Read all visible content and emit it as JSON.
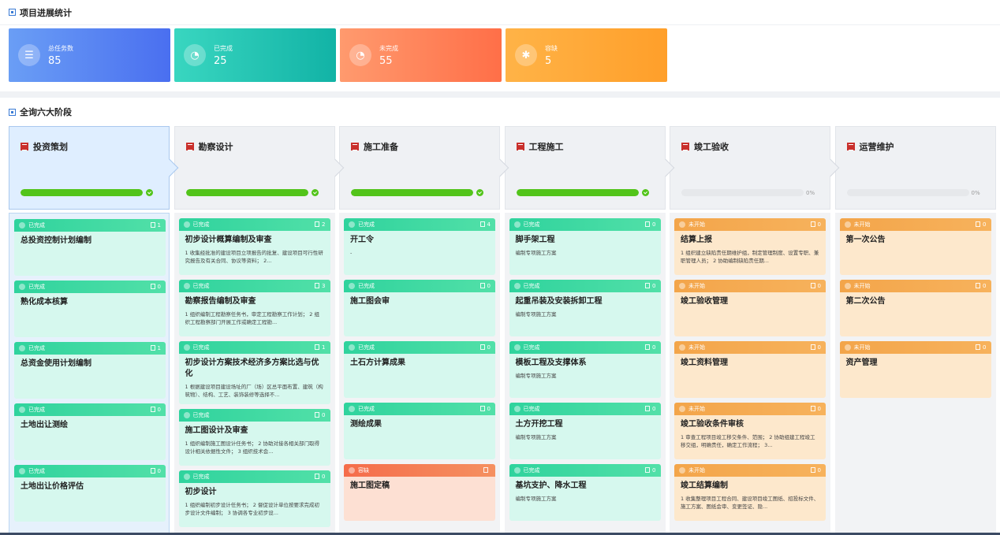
{
  "progress_section": {
    "title": "项目进展统计"
  },
  "stats": [
    {
      "label": "总任务数",
      "value": "85",
      "icon": "layers-icon"
    },
    {
      "label": "已完成",
      "value": "25",
      "icon": "chart-icon"
    },
    {
      "label": "未完成",
      "value": "55",
      "icon": "chart-icon"
    },
    {
      "label": "容缺",
      "value": "5",
      "icon": "puzzle-icon"
    }
  ],
  "stages_section": {
    "title": "全询六大阶段"
  },
  "colors": {
    "done": "#2fd39d",
    "todo": "#f3a54a",
    "missing": "#f56c4a",
    "progress": "#52c41a"
  },
  "stages": [
    {
      "name": "投资策划",
      "progress": 100,
      "pct_text": ""
    },
    {
      "name": "勘察设计",
      "progress": 100,
      "pct_text": ""
    },
    {
      "name": "施工准备",
      "progress": 100,
      "pct_text": ""
    },
    {
      "name": "工程施工",
      "progress": 100,
      "pct_text": ""
    },
    {
      "name": "竣工验收",
      "progress": 0,
      "pct_text": "0%"
    },
    {
      "name": "运营维护",
      "progress": 0,
      "pct_text": "0%"
    }
  ],
  "columns": [
    {
      "cards": [
        {
          "status": "done",
          "status_label": "已完成",
          "count": "1",
          "title": "总投资控制计划编制",
          "desc": ""
        },
        {
          "status": "done",
          "status_label": "已完成",
          "count": "0",
          "title": "熟化成本核算",
          "desc": ""
        },
        {
          "status": "done",
          "status_label": "已完成",
          "count": "1",
          "title": "总资金使用计划编制",
          "desc": ""
        },
        {
          "status": "done",
          "status_label": "已完成",
          "count": "0",
          "title": "土地出让测绘",
          "desc": ""
        },
        {
          "status": "done",
          "status_label": "已完成",
          "count": "0",
          "title": "土地出让价格评估",
          "desc": ""
        }
      ]
    },
    {
      "cards": [
        {
          "status": "done",
          "status_label": "已完成",
          "count": "2",
          "title": "初步设计概算编制及审查",
          "desc": "1 收集经批准的建设项目立项报告的批复、建设项目可行性研究报告及有关合同、协议等资料； 2..."
        },
        {
          "status": "done",
          "status_label": "已完成",
          "count": "3",
          "title": "勘察报告编制及审查",
          "desc": "1 组织编制工程勘察任务书，审定工程勘察工作计划； 2 组织工程勘察部门开展工作或确定工程勘..."
        },
        {
          "status": "done",
          "status_label": "已完成",
          "count": "1",
          "title": "初步设计方案技术经济多方案比选与优化",
          "desc": "1 根据建设项目建设场址的厂（场）区总平面布置、建筑（构筑物）、结构、工艺、装饰装修等选择不..."
        },
        {
          "status": "done",
          "status_label": "已完成",
          "count": "0",
          "title": "施工图设计及审查",
          "desc": "1 组织编制施工图设计任务书； 2 协助对接各相关部门取得设计相关依据性文件； 3 组织技术会..."
        },
        {
          "status": "done",
          "status_label": "已完成",
          "count": "0",
          "title": "初步设计",
          "desc": "1 组织编制初步设计任务书； 2 督促设计单位按要求完成初步设计文件编制； 3 协调各专业初步设..."
        }
      ]
    },
    {
      "cards": [
        {
          "status": "done",
          "status_label": "已完成",
          "count": "4",
          "title": "开工令",
          "desc": "-"
        },
        {
          "status": "done",
          "status_label": "已完成",
          "count": "0",
          "title": "施工图会审",
          "desc": ""
        },
        {
          "status": "done",
          "status_label": "已完成",
          "count": "0",
          "title": "土石方计算成果",
          "desc": ""
        },
        {
          "status": "done",
          "status_label": "已完成",
          "count": "0",
          "title": "测绘成果",
          "desc": ""
        },
        {
          "status": "missing",
          "status_label": "容缺",
          "count": "",
          "title": "施工图定稿",
          "desc": ""
        }
      ]
    },
    {
      "cards": [
        {
          "status": "done",
          "status_label": "已完成",
          "count": "0",
          "title": "脚手架工程",
          "desc": "编制专项施工方案"
        },
        {
          "status": "done",
          "status_label": "已完成",
          "count": "0",
          "title": "起重吊装及安装拆卸工程",
          "desc": "编制专项施工方案"
        },
        {
          "status": "done",
          "status_label": "已完成",
          "count": "0",
          "title": "模板工程及支撑体系",
          "desc": "编制专项施工方案"
        },
        {
          "status": "done",
          "status_label": "已完成",
          "count": "0",
          "title": "土方开挖工程",
          "desc": "编制专项施工方案"
        },
        {
          "status": "done",
          "status_label": "已完成",
          "count": "0",
          "title": "基坑支护、降水工程",
          "desc": "编制专项施工方案"
        }
      ]
    },
    {
      "cards": [
        {
          "status": "todo",
          "status_label": "未开始",
          "count": "0",
          "title": "结算上报",
          "desc": "1 组织建立缺陷责任期维护组，制定管理制度、设置专职、兼职管理人员； 2 协助编制缺陷责任期..."
        },
        {
          "status": "todo",
          "status_label": "未开始",
          "count": "0",
          "title": "竣工验收管理",
          "desc": ""
        },
        {
          "status": "todo",
          "status_label": "未开始",
          "count": "0",
          "title": "竣工资料管理",
          "desc": ""
        },
        {
          "status": "todo",
          "status_label": "未开始",
          "count": "0",
          "title": "竣工验收条件审核",
          "desc": "1 审查工程项目竣工移交条件、范围； 2 协助组建工程竣工移交组，明确责任，确定工作流程； 3..."
        },
        {
          "status": "todo",
          "status_label": "未开始",
          "count": "0",
          "title": "竣工结算编制",
          "desc": "1 收集整理项目工程合同、建设项目竣工图纸、招投标文件、施工方案、图纸会审、变更签证、隐..."
        }
      ]
    },
    {
      "cards": [
        {
          "status": "todo",
          "status_label": "未开始",
          "count": "0",
          "title": "第一次公告",
          "desc": ""
        },
        {
          "status": "todo",
          "status_label": "未开始",
          "count": "0",
          "title": "第二次公告",
          "desc": ""
        },
        {
          "status": "todo",
          "status_label": "未开始",
          "count": "0",
          "title": "资产管理",
          "desc": ""
        }
      ]
    }
  ]
}
